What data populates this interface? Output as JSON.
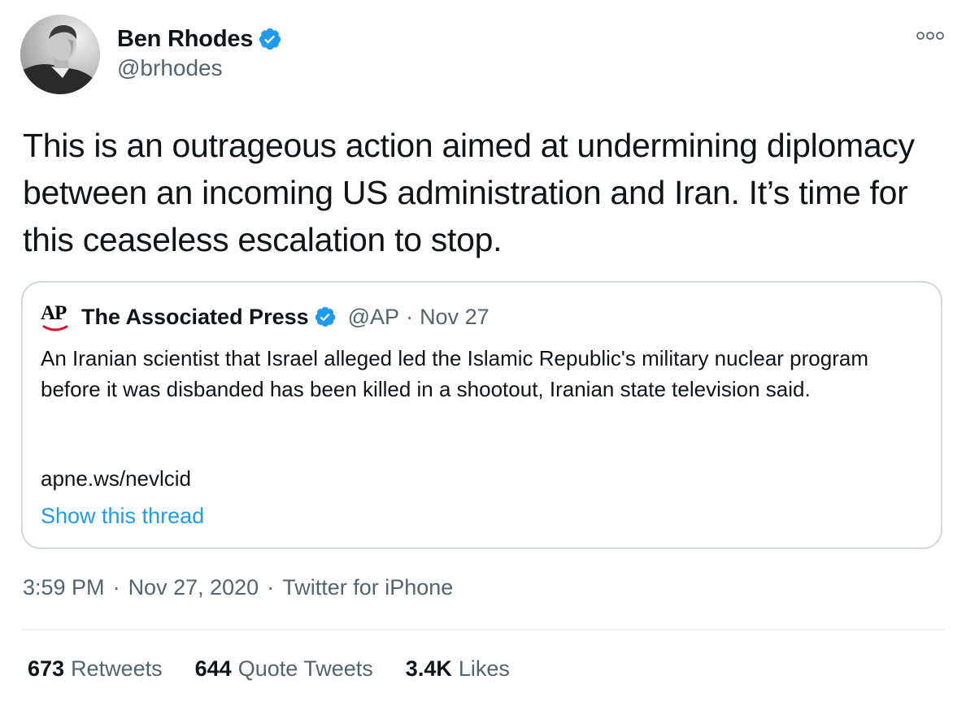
{
  "author": {
    "name": "Ben Rhodes",
    "handle": "@brhodes",
    "verified": true
  },
  "tweet_text": "This is an outrageous action aimed at undermining diplomacy between an incoming US administration and Iran. It’s time for this ceaseless escalation to stop.",
  "quoted_tweet": {
    "logo_text": "AP",
    "name": "The Associated Press",
    "handle": "@AP",
    "dot": "·",
    "date": "Nov 27",
    "body": "An Iranian scientist that Israel alleged led the Islamic Republic's military nuclear program before it was disbanded has been killed in a shootout, Iranian state television said.",
    "link": "apne.ws/nevlcid",
    "show_thread": "Show this thread"
  },
  "meta": {
    "time": "3:59 PM",
    "date": "Nov 27, 2020",
    "source": "Twitter for iPhone",
    "sep": "·"
  },
  "stats": {
    "retweets_count": "673",
    "retweets_label": "Retweets",
    "quotes_count": "644",
    "quotes_label": "Quote Tweets",
    "likes_count": "3.4K",
    "likes_label": "Likes"
  },
  "colors": {
    "verified_blue": "#1d9bf0",
    "secondary_text": "#536471",
    "primary_text": "#0f1419",
    "border": "#cfd9de",
    "ap_red": "#e4002b"
  },
  "icons": {
    "verified": "verified-badge-icon",
    "more": "more-options-icon",
    "avatar": "avatar-photo"
  }
}
